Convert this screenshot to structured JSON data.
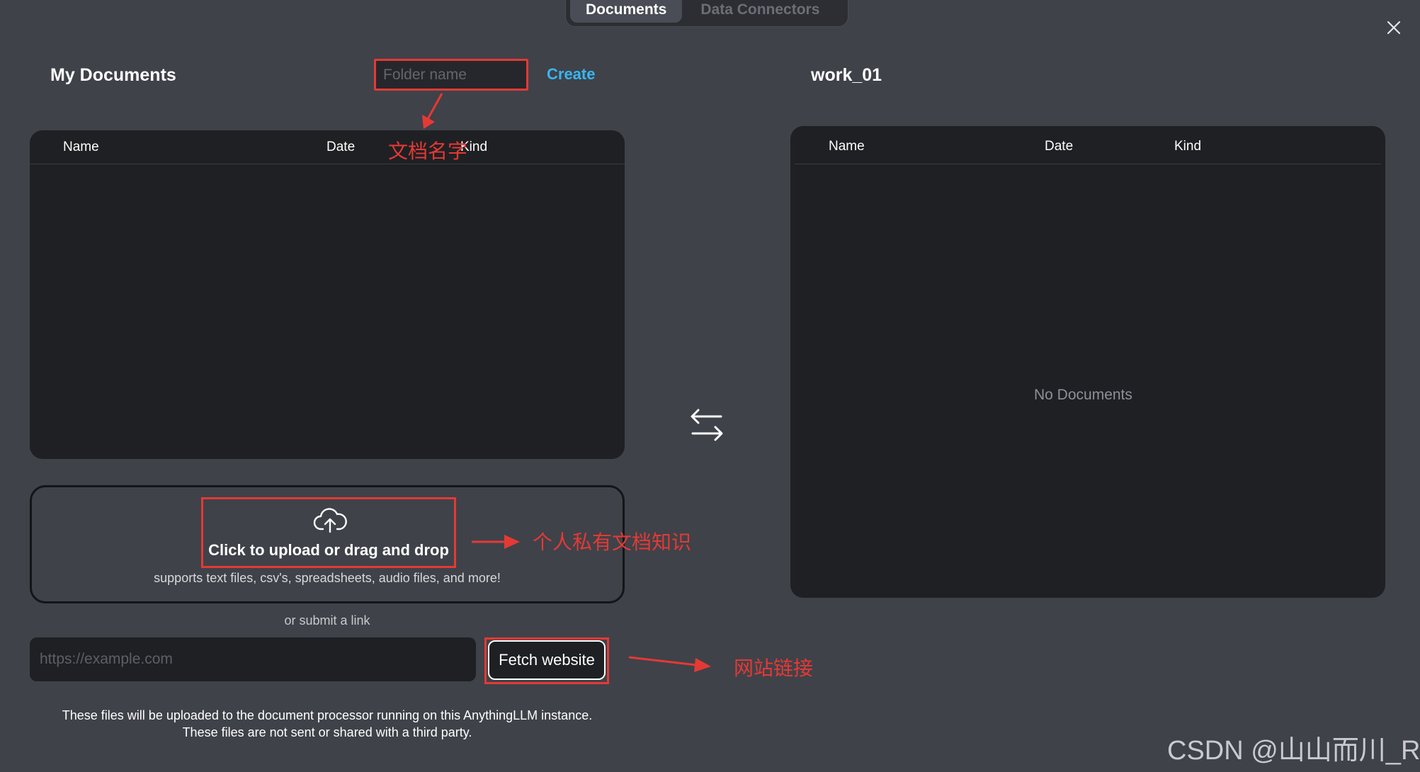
{
  "tabs": [
    {
      "label": "Documents",
      "active": true
    },
    {
      "label": "Data Connectors",
      "active": false
    }
  ],
  "left": {
    "title": "My Documents",
    "folder_placeholder": "Folder name",
    "create_label": "Create",
    "columns": [
      "Name",
      "Date",
      "Kind"
    ]
  },
  "right": {
    "title": "work_01",
    "columns": [
      "Name",
      "Date",
      "Kind"
    ],
    "empty_text": "No Documents"
  },
  "upload": {
    "title": "Click to upload or drag and drop",
    "subtitle": "supports text files, csv's, spreadsheets, audio files, and more!",
    "or_link": "or submit a link",
    "url_placeholder": "https://example.com",
    "fetch_label": "Fetch website"
  },
  "footer": {
    "line1": "These files will be uploaded to the document processor running on this AnythingLLM instance.",
    "line2": "These files are not sent or shared with a third party."
  },
  "annotations": {
    "doc_name": "文档名字",
    "private_docs": "个人私有文档知识",
    "website_link": "网站链接"
  },
  "watermark": "CSDN @山山而川_R",
  "colors": {
    "background": "#3f4249",
    "panel": "#1f2023",
    "accent_link": "#38b6f0",
    "annotation_red": "#e53935"
  },
  "icons": [
    "close-icon",
    "swap-arrows-icon",
    "cloud-upload-icon"
  ]
}
